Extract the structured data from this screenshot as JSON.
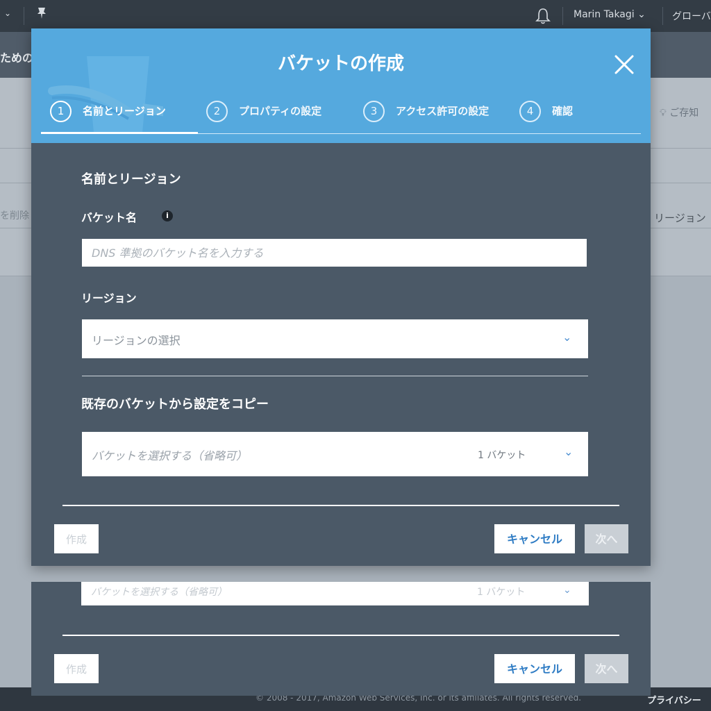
{
  "topbar": {
    "user": "Marin Takagi ⌄",
    "region": "グローバ"
  },
  "subbar": {
    "title": "ためのミ"
  },
  "background": {
    "hint": "ご存知",
    "delete_label": "を削除",
    "region_header": "リージョン"
  },
  "footer": {
    "copyright": "© 2008 - 2017, Amazon Web Services, Inc. or its affiliates. All rights reserved.",
    "privacy": "プライバシー"
  },
  "dialog": {
    "title": "バケットの作成",
    "steps": [
      {
        "num": "1",
        "label": "名前とリージョン"
      },
      {
        "num": "2",
        "label": "プロパティの設定"
      },
      {
        "num": "3",
        "label": "アクセス許可の設定"
      },
      {
        "num": "4",
        "label": "確認"
      }
    ],
    "section_title": "名前とリージョン",
    "bucket_name_label": "バケット名",
    "bucket_name_placeholder": "DNS 準拠のバケット名を入力する",
    "region_label": "リージョン",
    "region_select": "リージョンの選択",
    "copy_title": "既存のバケットから設定をコピー",
    "copy_select_placeholder": "バケットを選択する（省略可）",
    "copy_count": "1 バケット",
    "buttons": {
      "create": "作成",
      "cancel": "キャンセル",
      "next": "次へ"
    }
  },
  "colors": {
    "header_blue": "#55a9de",
    "dialog_body": "#4b5967",
    "link_blue": "#2f7cc4"
  },
  "icons": [
    "chevron-down-icon",
    "pin-icon",
    "bell-icon",
    "close-icon",
    "info-icon"
  ]
}
